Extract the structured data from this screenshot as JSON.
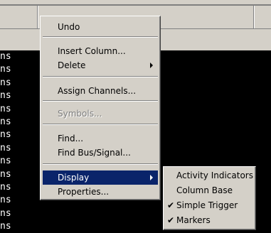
{
  "background": {
    "timing_units": [
      "ns",
      "ns",
      "ns",
      "ns",
      "ns",
      "ns",
      "ns",
      "ns",
      "ns",
      "ns",
      "ns",
      "ns",
      "ns",
      "ns"
    ]
  },
  "context_menu": {
    "items": [
      {
        "label": "Undo"
      },
      {
        "label": "Insert Column..."
      },
      {
        "label": "Delete",
        "has_submenu": true
      },
      {
        "label": "Assign Channels..."
      },
      {
        "label": "Symbols...",
        "disabled": true
      },
      {
        "label": "Find..."
      },
      {
        "label": "Find Bus/Signal..."
      },
      {
        "label": "Display",
        "has_submenu": true,
        "highlighted": true
      },
      {
        "label": "Properties..."
      }
    ]
  },
  "display_submenu": {
    "items": [
      {
        "label": "Activity Indicators",
        "checked": false
      },
      {
        "label": "Column Base",
        "checked": false
      },
      {
        "label": "Simple Trigger",
        "checked": true
      },
      {
        "label": "Markers",
        "checked": true
      }
    ]
  },
  "colors": {
    "menu_bg": "#d4d0c8",
    "highlight": "#0a246a",
    "waveform_bg": "#000000"
  }
}
